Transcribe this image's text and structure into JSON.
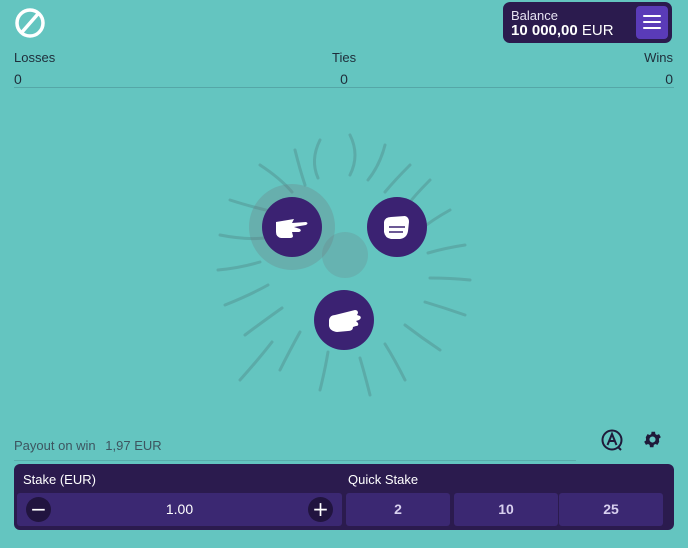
{
  "header": {
    "logo_icon": "slashed-circle-logo-icon",
    "balance_label": "Balance",
    "balance_amount": "10 000,00",
    "balance_currency": "EUR",
    "menu_icon": "hamburger-menu-icon"
  },
  "scoreboard": {
    "losses_label": "Losses",
    "losses_value": "0",
    "ties_label": "Ties",
    "ties_value": "0",
    "wins_label": "Wins",
    "wins_value": "0"
  },
  "choices": [
    {
      "name": "scissors",
      "icon": "scissors-hand-icon",
      "selected": true
    },
    {
      "name": "rock",
      "icon": "rock-fist-icon",
      "selected": false
    },
    {
      "name": "paper",
      "icon": "paper-hand-icon",
      "selected": false
    }
  ],
  "payout": {
    "label": "Payout on win",
    "amount": "1,97 EUR"
  },
  "controls": {
    "auto_icon": "autoplay-a-icon",
    "settings_icon": "gear-icon"
  },
  "stake": {
    "label": "Stake (EUR)",
    "value": "1.00",
    "decrease": "−",
    "increase": "+"
  },
  "quick_stake": {
    "label": "Quick Stake",
    "options": [
      "2",
      "10",
      "25"
    ]
  },
  "colors": {
    "background": "#64c5c0",
    "panel": "#2b1b4e",
    "accent": "#5a3bb8",
    "button": "#3b2272"
  }
}
